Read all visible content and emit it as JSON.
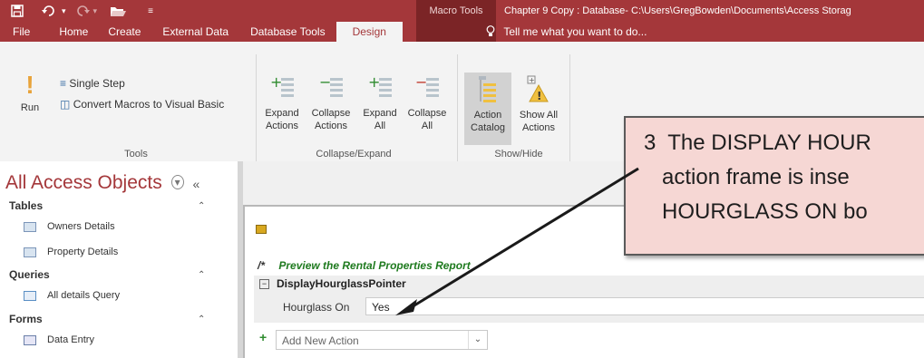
{
  "titlebar": {
    "contextual_label": "Macro Tools",
    "window_title": "Chapter 9 Copy : Database- C:\\Users\\GregBowden\\Documents\\Access Storag"
  },
  "tabs": [
    "File",
    "Home",
    "Create",
    "External Data",
    "Database Tools",
    "Design"
  ],
  "active_tab": "Design",
  "tell_me": "Tell me what you want to do...",
  "ribbon": {
    "tools": {
      "run": "Run",
      "single_step": "Single Step",
      "convert": "Convert Macros to Visual Basic",
      "label": "Tools"
    },
    "collapse_expand": {
      "expand_actions": [
        "Expand",
        "Actions"
      ],
      "collapse_actions": [
        "Collapse",
        "Actions"
      ],
      "expand_all": [
        "Expand",
        "All"
      ],
      "collapse_all": [
        "Collapse",
        "All"
      ],
      "label": "Collapse/Expand"
    },
    "show_hide": {
      "action_catalog": [
        "Action",
        "Catalog"
      ],
      "show_all_actions": [
        "Show All",
        "Actions"
      ],
      "label": "Show/Hide"
    }
  },
  "nav": {
    "title": "All Access Objects",
    "groups": [
      {
        "name": "Tables",
        "items": [
          "Owners Details",
          "Property Details"
        ]
      },
      {
        "name": "Queries",
        "items": [
          "All details Query"
        ]
      },
      {
        "name": "Forms",
        "items": [
          "Data Entry"
        ]
      }
    ]
  },
  "macro": {
    "comment": "Preview the Rental Properties Report",
    "comment_prefix": "/*",
    "action_name": "DisplayHourglassPointer",
    "arg_label": "Hourglass On",
    "arg_value": "Yes",
    "add_action_placeholder": "Add New Action"
  },
  "callout": {
    "lines": [
      "3  The DISPLAY HOUR",
      "action frame is inse",
      "HOURGLASS ON bo"
    ]
  },
  "colors": {
    "brand": "#a4373a",
    "contextual": "#7b2426",
    "callout_fill": "#f6d7d4",
    "comment_green": "#1e7a1e"
  }
}
